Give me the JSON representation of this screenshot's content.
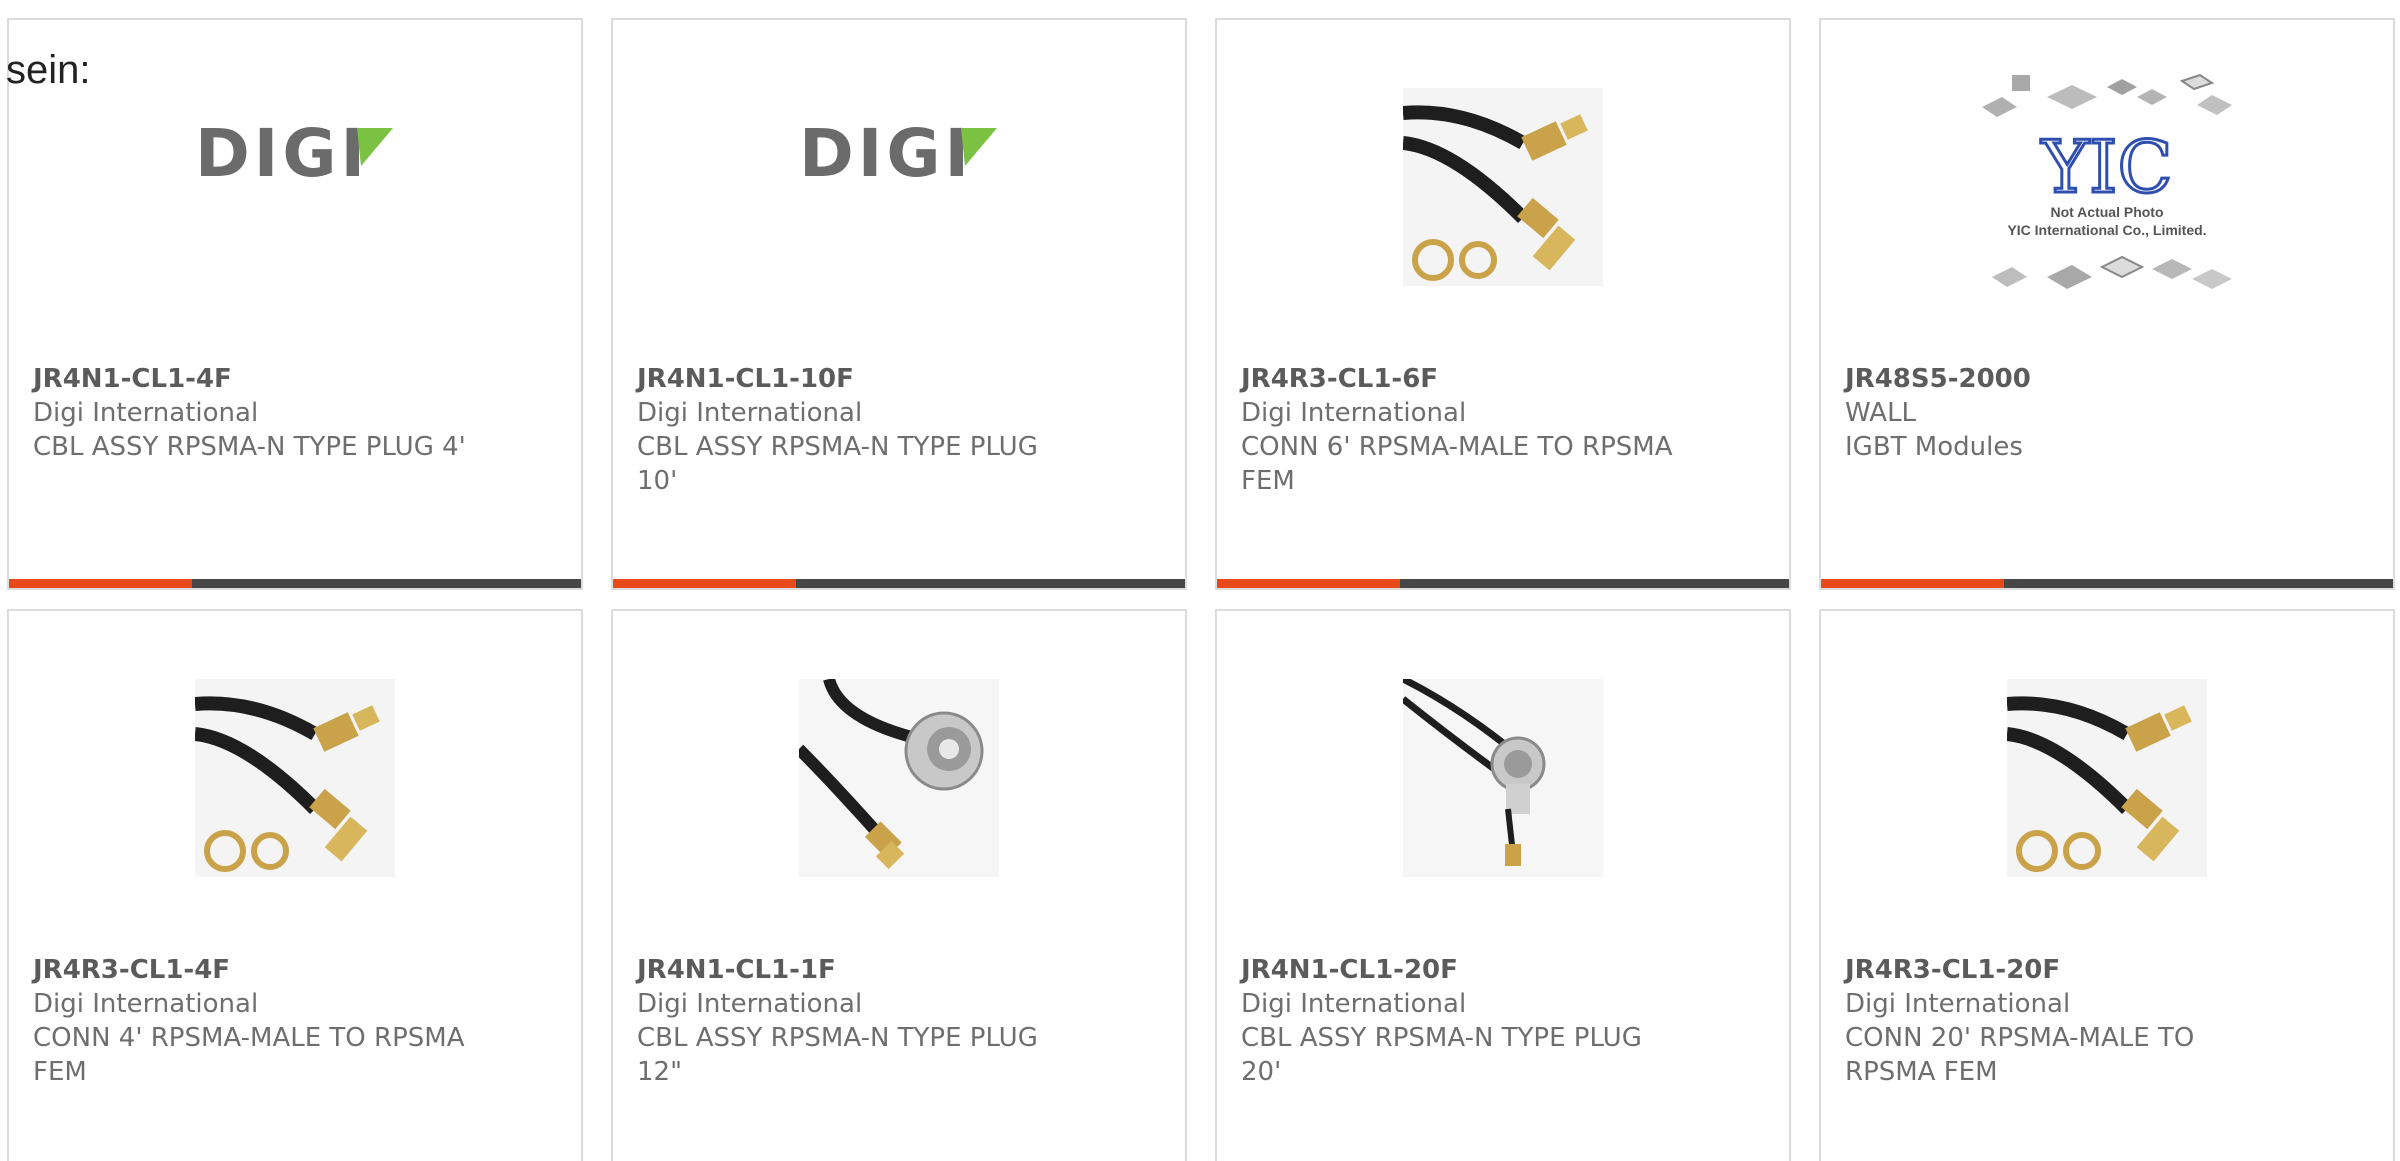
{
  "heading": "sein:",
  "cards": [
    {
      "part": "JR4N1-CL1-4F",
      "maker": "Digi International",
      "desc": "CBL ASSY RPSMA-N TYPE PLUG 4'",
      "image": "digi-logo-image"
    },
    {
      "part": "JR4N1-CL1-10F",
      "maker": "Digi International",
      "desc": "CBL ASSY RPSMA-N TYPE PLUG\n10'",
      "image": "digi-logo-image"
    },
    {
      "part": "JR4R3-CL1-6F",
      "maker": "Digi International",
      "desc": "CONN 6' RPSMA-MALE TO RPSMA\nFEM",
      "image": "rpsma-cable-image"
    },
    {
      "part": "JR48S5-2000",
      "maker": "WALL",
      "desc": "IGBT Modules",
      "image": "yic-placeholder-image",
      "placeholder_lines": [
        "Not Actual Photo",
        "YIC International Co., Limited."
      ]
    },
    {
      "part": "JR4R3-CL1-4F",
      "maker": "Digi International",
      "desc": "CONN 4' RPSMA-MALE TO RPSMA\nFEM",
      "image": "rpsma-cable-image"
    },
    {
      "part": "JR4N1-CL1-1F",
      "maker": "Digi International",
      "desc": "CBL ASSY RPSMA-N TYPE PLUG\n12\"",
      "image": "n-type-cable-image"
    },
    {
      "part": "JR4N1-CL1-20F",
      "maker": "Digi International",
      "desc": "CBL ASSY RPSMA-N TYPE PLUG\n20'",
      "image": "n-type-cable-image-2"
    },
    {
      "part": "JR4R3-CL1-20F",
      "maker": "Digi International",
      "desc": "CONN 20' RPSMA-MALE TO\nRPSMA FEM",
      "image": "rpsma-cable-image"
    }
  ],
  "colors": {
    "accent": "#e84a1c",
    "bar": "#474747",
    "border": "#dcdcdc",
    "text": "#6e6e6e"
  }
}
